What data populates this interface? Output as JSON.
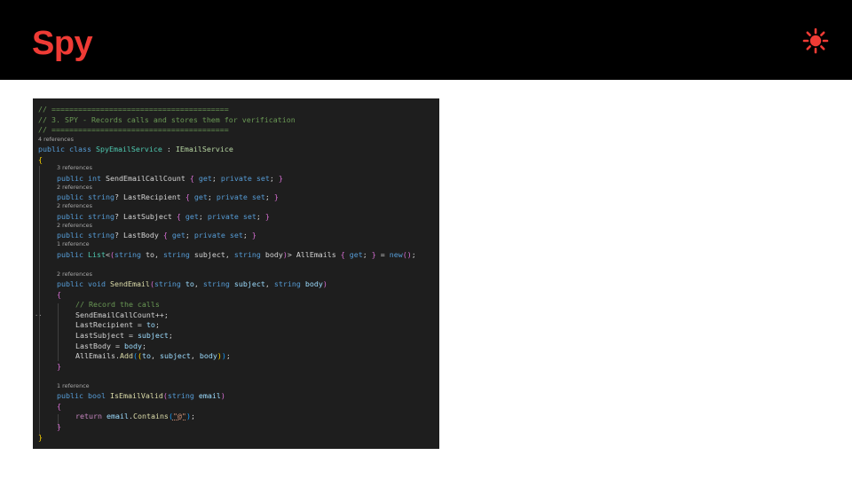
{
  "slide": {
    "title": "Spy",
    "icon": "sun-icon",
    "accent_color": "#ef3b35"
  },
  "code": {
    "line_1": "// ========================================",
    "line_2": "// 3. SPY - Records calls and stores them for verification",
    "line_3": "// ========================================",
    "lens_class": "4 references",
    "lens_send_count": "3 references",
    "lens_last_recipient": "2 references",
    "lens_last_subject": "2 references",
    "lens_last_body": "2 references",
    "lens_all_emails": "1 reference",
    "lens_send_email": "2 references",
    "comment_record": "// Record the calls",
    "lens_is_valid": "1 reference",
    "string_at": "\"@\""
  },
  "colors": {
    "editor_background": "#1e1e1e",
    "comment": "#6a9955",
    "keyword": "#569cd6",
    "control_keyword": "#c586c0",
    "type": "#4ec9b0",
    "interface": "#b8d7a3",
    "method": "#dcdcaa",
    "parameter": "#9cdcfe",
    "string": "#ce9178"
  }
}
